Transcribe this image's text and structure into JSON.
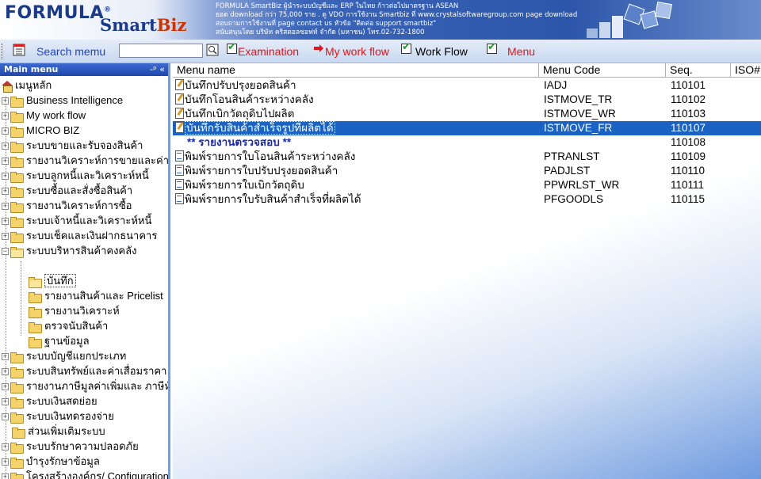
{
  "banner": {
    "logo_formula": "FORMULA",
    "logo_trademark": "®",
    "logo_smart": "Smart",
    "logo_biz": "Biz",
    "info_lines": [
      "FORMULA SmartBiz ผู้นำระบบบัญชีและ ERP ในไทย ก้าวต่อไปมาตรฐาน ASEAN",
      "ยอด download กว่า 75,000 ราย . ดู VDO การใช้งาน Smartbiz ที่ www.crystalsoftwaregroup.com page download",
      "สอบถามการใช้งานที่ page contact us หัวข้อ \"ติดต่อ support smartbiz\"",
      "สนับสนุนโดย บริษัท คริสตอลซอฟท์ จำกัด (มหาชน) โทร.02-732-1800"
    ]
  },
  "toolbar": {
    "search_label": "Search memu",
    "search_value": "",
    "examination_label": "Examination",
    "myworkflow_label": "My work flow",
    "workflow_label": "Work Flow",
    "menu_label": "Menu"
  },
  "sidebar": {
    "title": "Main menu",
    "header_buttons": "-ᵖ «",
    "root_label": "เมนูหลัก",
    "items": [
      "Business Intelligence",
      "My work flow",
      "MICRO BIZ",
      "ระบบขายและรับจองสินค้า",
      "รายงานวิเคราะห์การขายและค่าคอม",
      "ระบบลูกหนี้และวิเคราะห์หนี้",
      "ระบบซื้อและสั่งซื้อสินค้า",
      "รายงานวิเคราะห์การซื้อ",
      "ระบบเจ้าหนี้และวิเคราะห์หนี้",
      "ระบบเช็คและเงินฝากธนาคาร",
      "ระบบบริหารสินค้าคงคลัง"
    ],
    "subitems": [
      "บันทึก",
      "รายงานสินค้าและ Pricelist",
      "รายงานวิเคราะห์",
      "ตรวจนับสินค้า",
      "ฐานข้อมูล"
    ],
    "items_after": [
      "ระบบบัญชีแยกประเภท",
      "ระบบสินทรัพย์และค่าเสื่อมราคา",
      "รายงานภาษีมูลค่าเพิ่มและ ภาษีหัก",
      "ระบบเงินสดย่อย",
      "ระบบเงินทดรองจ่าย",
      "ส่วนเพิ่มเติมระบบ",
      "ระบบรักษาความปลอดภัย",
      "บำรุงรักษาข้อมูล",
      "โครงสร้างองค์กร/ Configuration"
    ]
  },
  "grid": {
    "columns": [
      "Menu name",
      "Menu Code",
      "Seq.",
      "ISO#"
    ],
    "rows": [
      {
        "name": "บันทึกปรับปรุงยอดสินค้า",
        "code": "IADJ",
        "seq": "110101",
        "icon": "edit-doc-icon"
      },
      {
        "name": "บันทึกโอนสินค้าระหว่างคลัง",
        "code": "ISTMOVE_TR",
        "seq": "110102",
        "icon": "edit-doc-icon"
      },
      {
        "name": "บันทึกเบิกวัตถุดิบไปผลิต",
        "code": "ISTMOVE_WR",
        "seq": "110103",
        "icon": "edit-doc-icon"
      },
      {
        "name": "บันทึกรับสินค้าสำเร็จรูปที่ผลิตได้",
        "code": "ISTMOVE_FR",
        "seq": "110107",
        "icon": "edit-doc-icon"
      },
      {
        "name": "** รายงานตรวจสอบ **",
        "code": "",
        "seq": "110108",
        "icon": ""
      },
      {
        "name": "พิมพ์รายการใบโอนสินค้าระหว่างคลัง",
        "code": "PTRANLST",
        "seq": "110109",
        "icon": "print-doc-icon"
      },
      {
        "name": "พิมพ์รายการใบปรับปรุงยอดสินค้า",
        "code": "PADJLST",
        "seq": "110110",
        "icon": "print-doc-icon"
      },
      {
        "name": "พิมพ์รายการใบเบิกวัตถุดิบ",
        "code": "PPWRLST_WR",
        "seq": "110111",
        "icon": "print-doc-icon"
      },
      {
        "name": "พิมพ์รายการใบรับสินค้าสำเร็จที่ผลิตได้",
        "code": "PFGOODLS",
        "seq": "110115",
        "icon": "print-doc-icon"
      }
    ]
  }
}
